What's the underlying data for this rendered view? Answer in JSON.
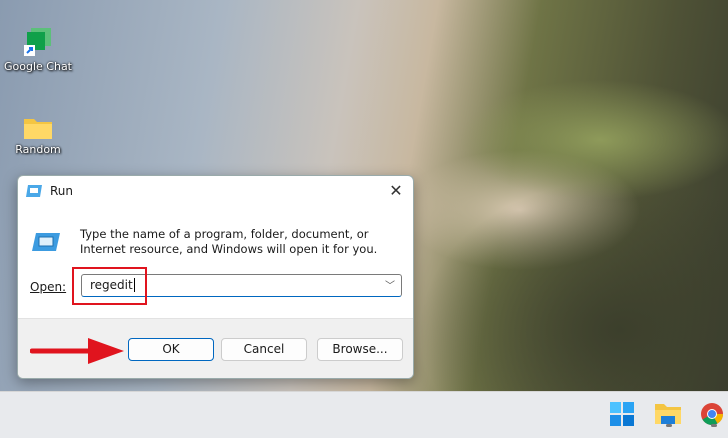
{
  "desktop": {
    "icons": [
      {
        "label": "Google Chat",
        "icon": "google-chat-icon"
      },
      {
        "label": "Random",
        "icon": "folder-icon"
      }
    ]
  },
  "dialog": {
    "title": "Run",
    "description": "Type the name of a program, folder, document, or Internet resource, and Windows will open it for you.",
    "open_label": "Open:",
    "open_value": "regedit",
    "buttons": {
      "ok": "OK",
      "cancel": "Cancel",
      "browse": "Browse..."
    }
  },
  "taskbar": {
    "items": [
      "windows-start-icon",
      "file-explorer-icon",
      "chrome-icon"
    ]
  },
  "colors": {
    "highlight": "#e0141e",
    "accent": "#0067c0"
  }
}
